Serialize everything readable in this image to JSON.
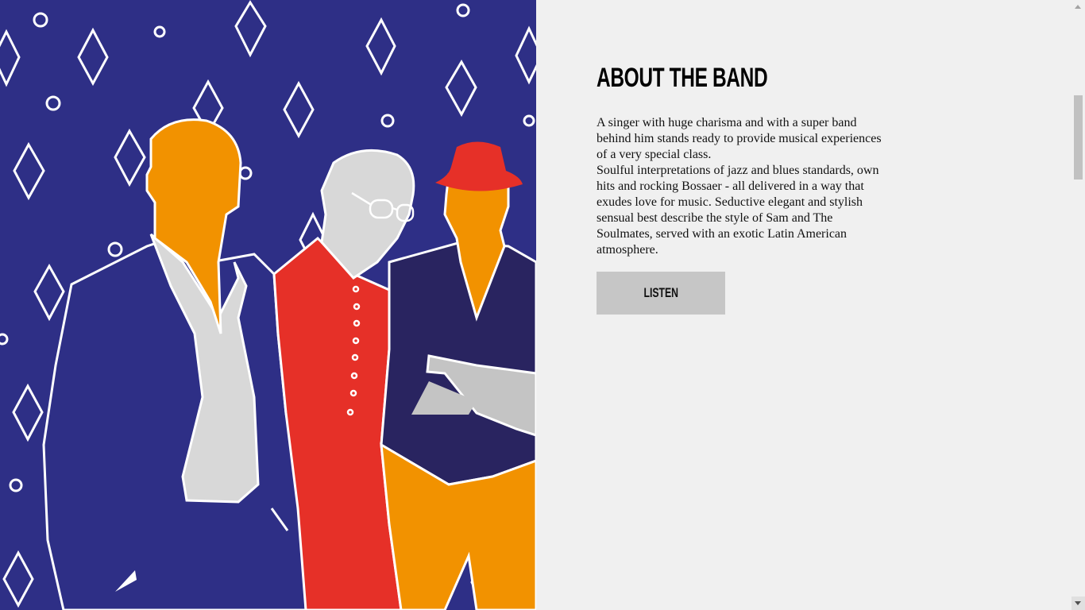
{
  "about": {
    "heading": "ABOUT THE BAND",
    "paragraph_1": "A singer with huge charisma and with a super band behind him stands ready to provide musical experiences of a very special class.",
    "paragraph_2": "Soulful interpretations of jazz and blues standards, own hits and rocking Bossaer - all delivered in a way that exudes love for music. Seductive elegant and stylish sensual best describe the style of Sam and The Soulmates, served with an exotic Latin American atmosphere.",
    "listen_label": "LISTEN"
  },
  "illustration": {
    "icon": "band-illustration",
    "colors": {
      "background": "#2e2f86",
      "orange": "#f29200",
      "red": "#e63028",
      "navy_vest": "#292460",
      "light_gray": "#d8d8d8",
      "mid_gray": "#c4c4c4",
      "outline": "#ffffff"
    }
  },
  "colors": {
    "page_background": "#f0f0f0",
    "button_background": "#c6c6c6",
    "text": "#111111"
  },
  "scrollbar": {
    "up_icon": "scroll-up-arrow-icon",
    "down_icon": "scroll-down-arrow-icon"
  }
}
